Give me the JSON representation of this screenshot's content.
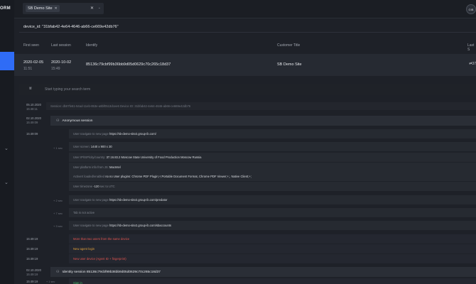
{
  "brand": {
    "logo_text": "ORM"
  },
  "topbar": {
    "site_chip": "SB Demo Site",
    "chip_remove": "✕",
    "clear": "✕",
    "chevron": "⌄",
    "avatar": "GIB"
  },
  "query": "device_id: \"31bfab42-4e64-4646-ab66-ce669e42db76\"",
  "table": {
    "headers": [
      "First seen",
      "Last session",
      "Identify",
      "Customer Title",
      "Last S"
    ],
    "row": {
      "first_seen_date": "2020-02-05",
      "first_seen_time": "11:51",
      "last_session_date": "2020-10-02",
      "last_session_time": "15:49",
      "identify": "85136c79cbf99b36bb9d05d0629c70c265c18d37",
      "customer_title": "SB Demo Site",
      "last_icon": "⇄37"
    }
  },
  "search": {
    "placeholder": "Start typing your search term"
  },
  "timeline": {
    "session": {
      "date": "05.10.2020",
      "time": "15:48:11",
      "text": "Session: db07fe61-54ad-11eb-853e-a8bf0513dcee6   Device ID: 31bfab42-4e64-4646-ab66-ce669e42db76"
    },
    "anon": {
      "date": "02.10.2020",
      "time": "15:49:09",
      "title": "Anonymous session"
    },
    "first_ts": "15:49:09",
    "events": [
      {
        "label": "User navigate to new page",
        "value": "https://sb-demo-site2.group-ib.com/",
        "rel": ""
      },
      {
        "label": "User screen:",
        "value": "1440 x 900 x 30",
        "rel": "+ 1 sec"
      },
      {
        "label": "User IP/ISP/city/country:",
        "value": "37.16.83.2 Moscow State University of Food Production Moscow Russia",
        "rel": ""
      },
      {
        "label": "User platform info from JS:",
        "value": "MacIntel",
        "rel": ""
      },
      {
        "label": "ActiveX loaded/enabled",
        "value": "no no User plugins: Chrome PDF Plugin;+;Portable Document Format, Chrome PDF Viewer;+;, Native Client;+;",
        "rel": ""
      },
      {
        "label": "User timezone",
        "value": "-120",
        "suffix": "sec to UTC",
        "rel": ""
      },
      {
        "label": "User navigate to new page",
        "value": "https://sb-demo-site2.group-ib.com/predator",
        "rel": "+ 2 sec"
      },
      {
        "label": "Tab is not active",
        "value": "",
        "rel": "+ 7 sec"
      },
      {
        "label": "User navigate to new page",
        "value": "https://sb-demo-site2.group-ib.com/sbaccounts",
        "rel": "+ 3 sec"
      }
    ],
    "alerts": [
      {
        "time": "15:49:19",
        "text": "More than two users from the same device",
        "kind": "red"
      },
      {
        "time": "15:49:19",
        "text": "New agent login",
        "kind": "orange"
      },
      {
        "time": "15:49:19",
        "text": "New user device (Agent ID + fingerprint)",
        "kind": "red"
      }
    ],
    "identity": {
      "date": "02.10.2020",
      "time": "15:49:19",
      "title": "Identity session 85136c79cbf99b36bb9d05d0629c70c265c18d37"
    },
    "last": {
      "time": "15:49:19",
      "rel": "+ 1 sec",
      "text": "Sign in"
    }
  }
}
